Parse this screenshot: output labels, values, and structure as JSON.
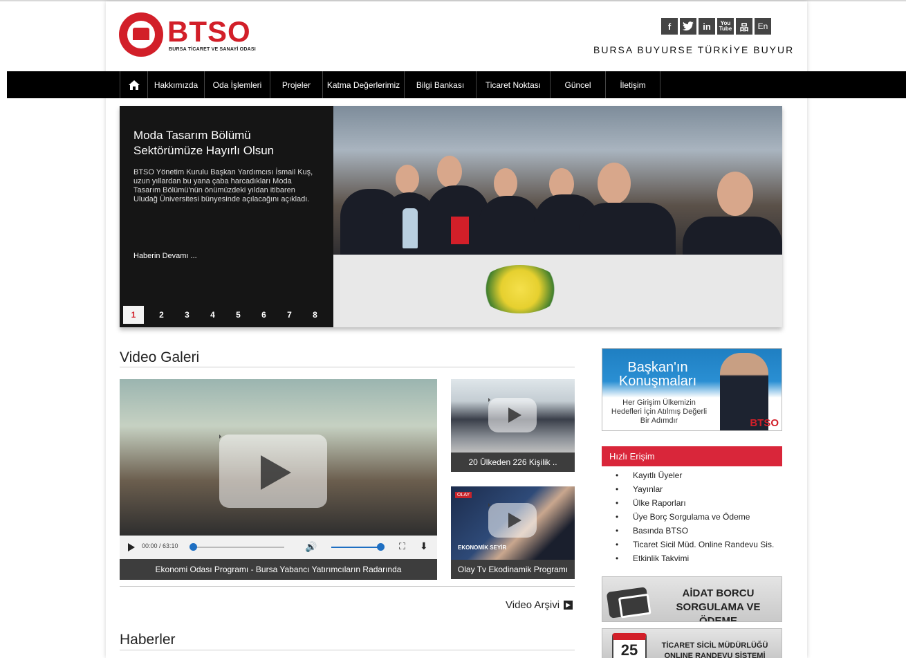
{
  "header": {
    "logo_word": "BTSO",
    "logo_sub": "BURSA TİCARET VE SANAYİ ODASI",
    "slogan": "BURSA BUYURSE TÜRKİYE BUYUR",
    "social": [
      {
        "icon": "facebook-icon",
        "label": "f"
      },
      {
        "icon": "twitter-icon",
        "label": "🐦"
      },
      {
        "icon": "linkedin-icon",
        "label": "in"
      },
      {
        "icon": "youtube-icon",
        "label": "You Tube"
      },
      {
        "icon": "sitemap-icon",
        "label": "品"
      },
      {
        "icon": "language-en",
        "label": "En"
      }
    ]
  },
  "nav": {
    "home_icon": "home-icon",
    "items": [
      "Hakkımızda",
      "Oda İşlemleri",
      "Projeler",
      "Katma Değerlerimiz",
      "Bilgi Bankası",
      "Ticaret Noktası",
      "Güncel",
      "İletişim"
    ]
  },
  "slider": {
    "title": "Moda Tasarım Bölümü Sektörümüze Hayırlı Olsun",
    "body": "BTSO Yönetim Kurulu Başkan Yardımcısı İsmail Kuş, uzun yıllardan bu yana çaba harcadıkları Moda Tasarım Bölümü'nün önümüzdeki yıldan itibaren Uludağ Üniversitesi bünyesinde açılacağını açıkladı.",
    "more": "Haberin Devamı ...",
    "pages": [
      "1",
      "2",
      "3",
      "4",
      "5",
      "6",
      "7",
      "8"
    ],
    "active_page": "1"
  },
  "video_gallery": {
    "heading": "Video Galeri",
    "main": {
      "time": "00:00 / 63:10",
      "caption": "Ekonomi Odası Programı - Bursa Yabancı Yatırımcıların Radarında",
      "progress": 0,
      "volume": 0.95
    },
    "side": [
      {
        "caption": "20 Ülkeden 226 Kişilik .."
      },
      {
        "caption": "Olay Tv Ekodinamik Programı",
        "thumb_text": "EKONOMİK SEYİR"
      }
    ],
    "archive": "Video Arşivi"
  },
  "news": {
    "heading": "Haberler"
  },
  "sidebar": {
    "baskan_title": "Başkan'ın Konuşmaları",
    "baskan_sub": "Her Girişim Ülkemizin Hedefleri İçin Atılmış Değerli Bir Adımdır",
    "baskan_tag": "BTSO",
    "quick_heading": "Hızlı Erişim",
    "quick_links": [
      "Kayıtlı Üyeler",
      "Yayınlar",
      "Ülke Raporları",
      "Üye Borç Sorgulama ve Ödeme",
      "Basında BTSO",
      "Ticaret Sicil Müd. Online Randevu Sis.",
      "Etkinlik Takvimi"
    ],
    "aidat_line1": "AİDAT BORCU",
    "aidat_line2": "SORGULAMA VE ÖDEME",
    "sicil_line1": "TİCARET SİCİL MÜDÜRLÜĞÜ",
    "sicil_line2": "ONLINE RANDEVU SİSTEMİ",
    "sicil_day": "25"
  }
}
